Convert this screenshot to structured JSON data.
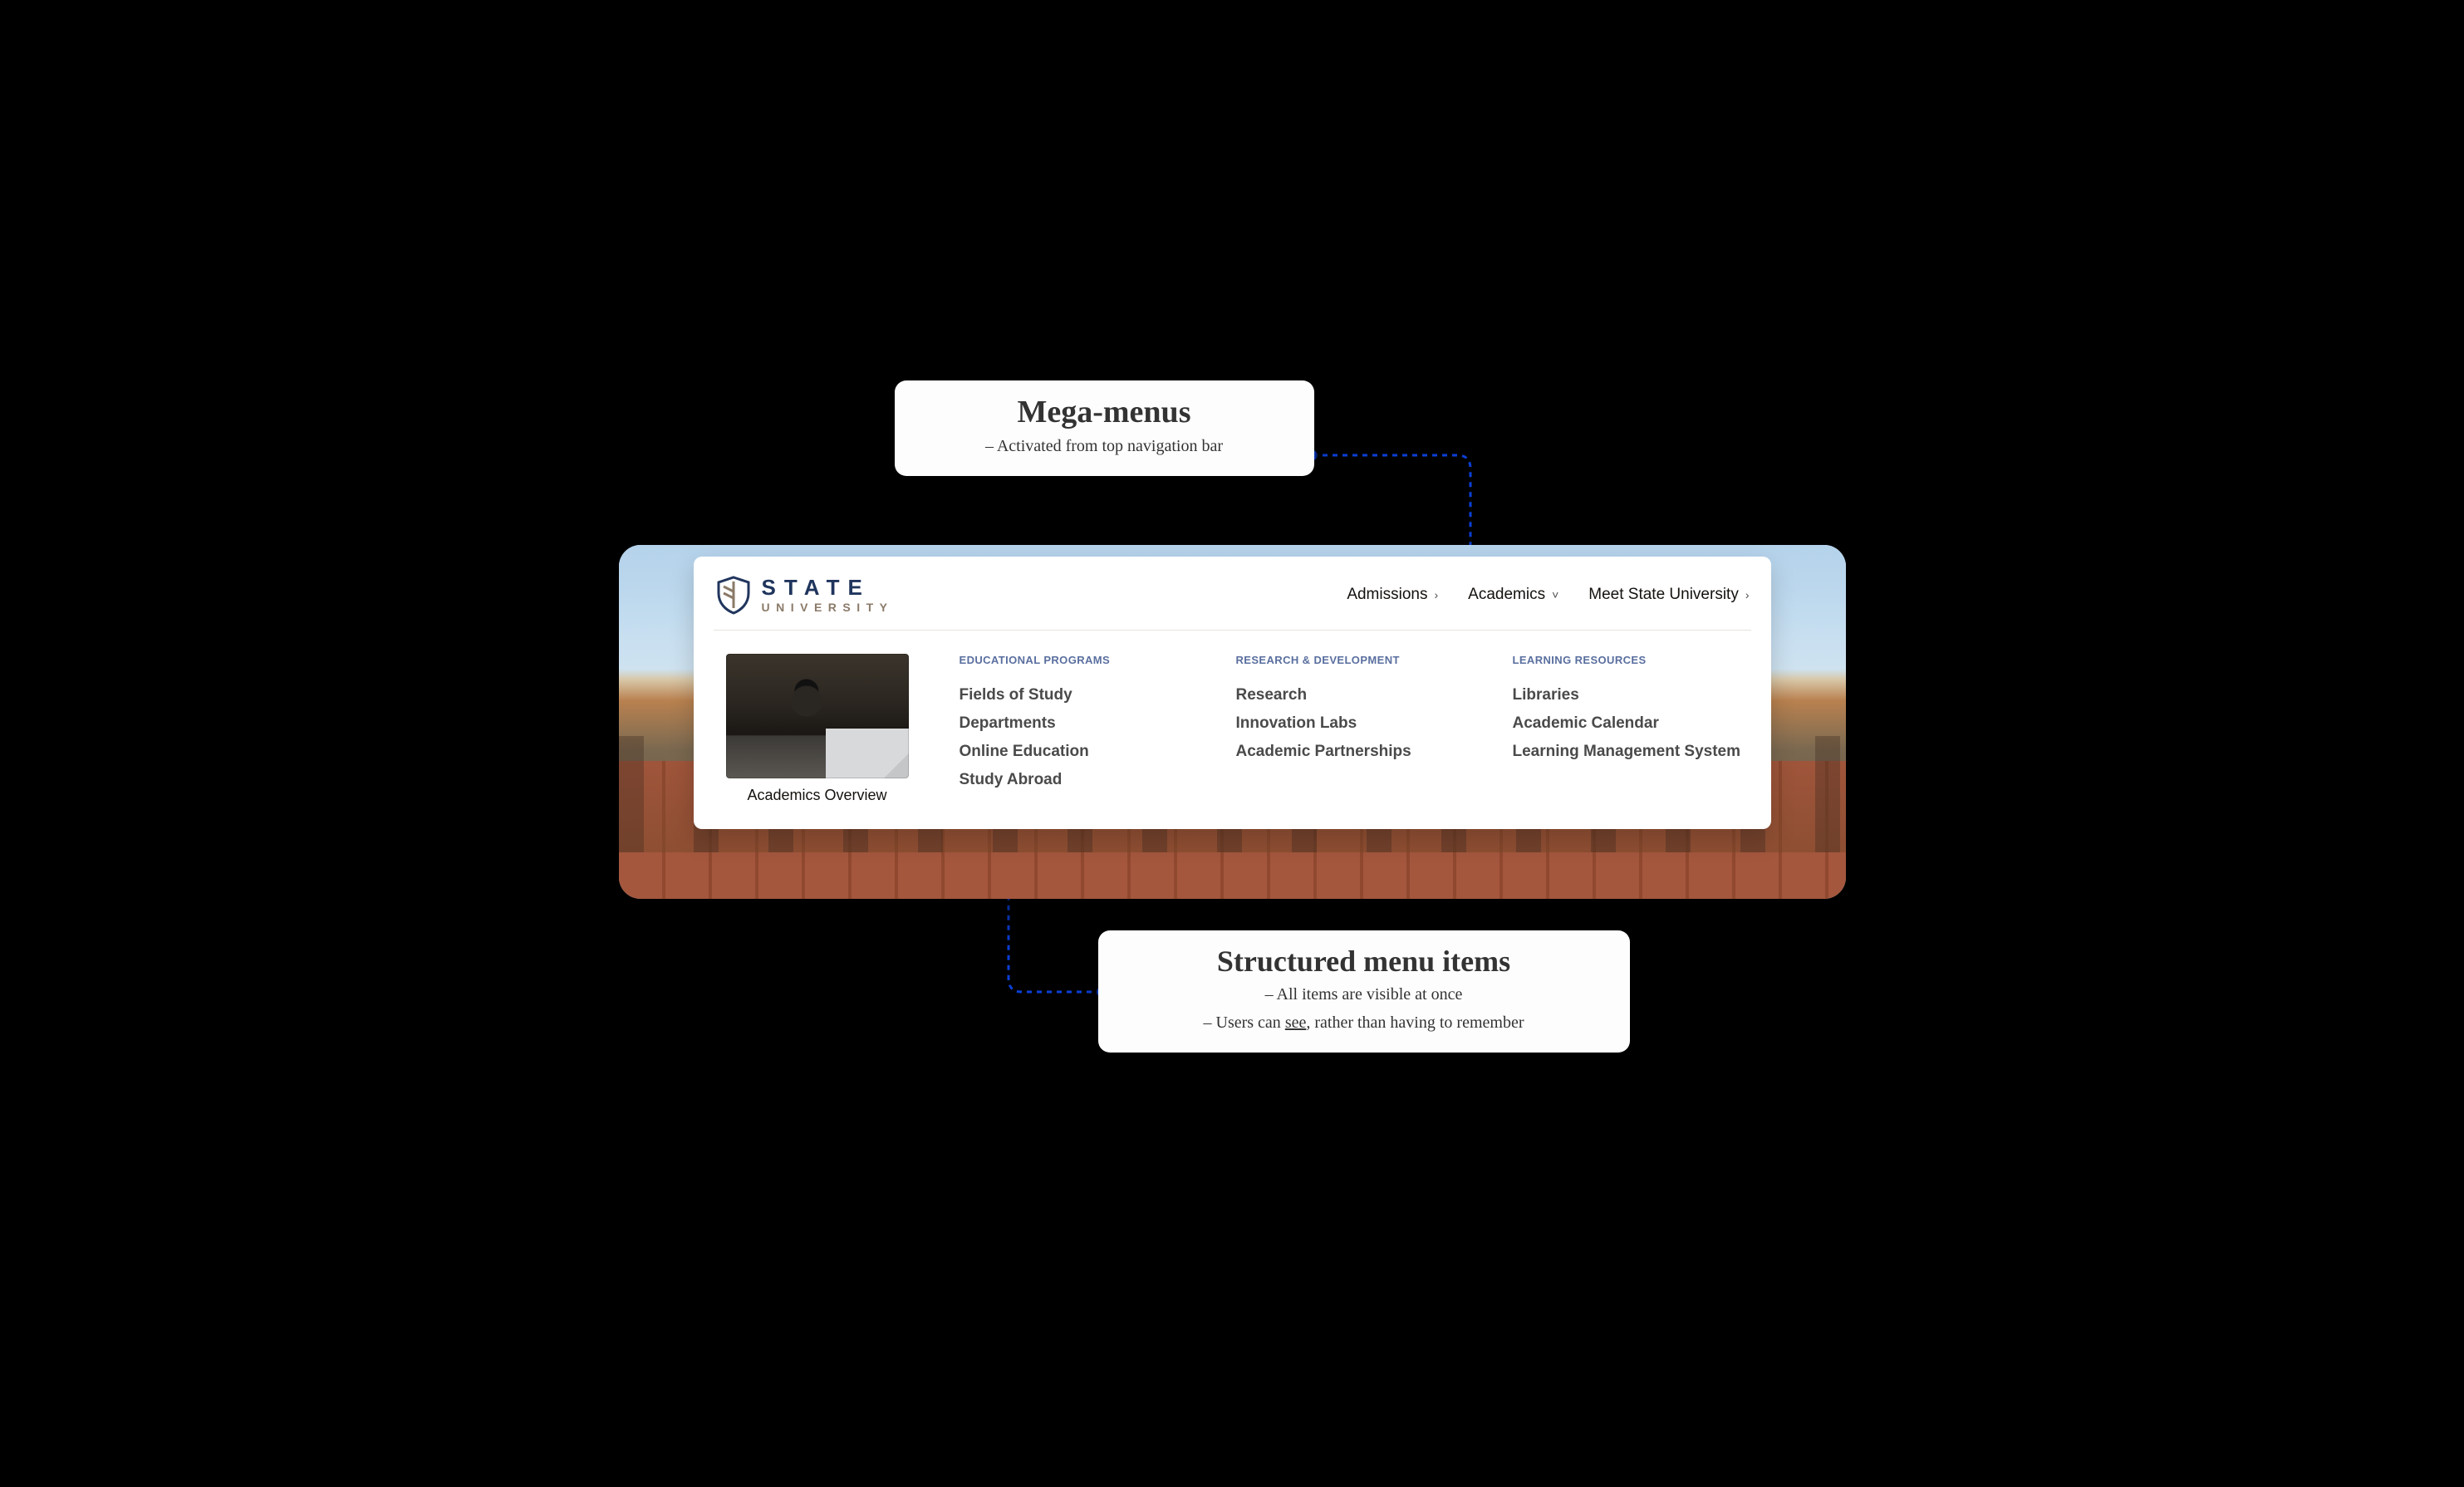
{
  "callouts": {
    "top": {
      "title": "Mega-menus",
      "subtitle": "– Activated from top navigation bar"
    },
    "bottom": {
      "title": "Structured menu items",
      "line1": "– All items are visible at once",
      "line2_pre": "– Users can ",
      "line2_u": "see",
      "line2_post": ", rather than having to remember"
    }
  },
  "logo": {
    "line1": "STATE",
    "line2": "UNIVERSITY"
  },
  "nav": {
    "items": [
      {
        "label": "Admissions",
        "chevron": "›"
      },
      {
        "label": "Academics",
        "chevron": "˅"
      },
      {
        "label": "Meet State University",
        "chevron": "›"
      }
    ]
  },
  "mega": {
    "overview_caption": "Academics Overview",
    "columns": [
      {
        "heading": "EDUCATIONAL PROGRAMS",
        "items": [
          "Fields of Study",
          "Departments",
          "Online Education",
          "Study Abroad"
        ]
      },
      {
        "heading": "RESEARCH & DEVELOPMENT",
        "items": [
          "Research",
          "Innovation Labs",
          "Academic Partnerships"
        ]
      },
      {
        "heading": "LEARNING RESOURCES",
        "items": [
          "Libraries",
          "Academic Calendar",
          "Learning Management System"
        ]
      }
    ]
  }
}
